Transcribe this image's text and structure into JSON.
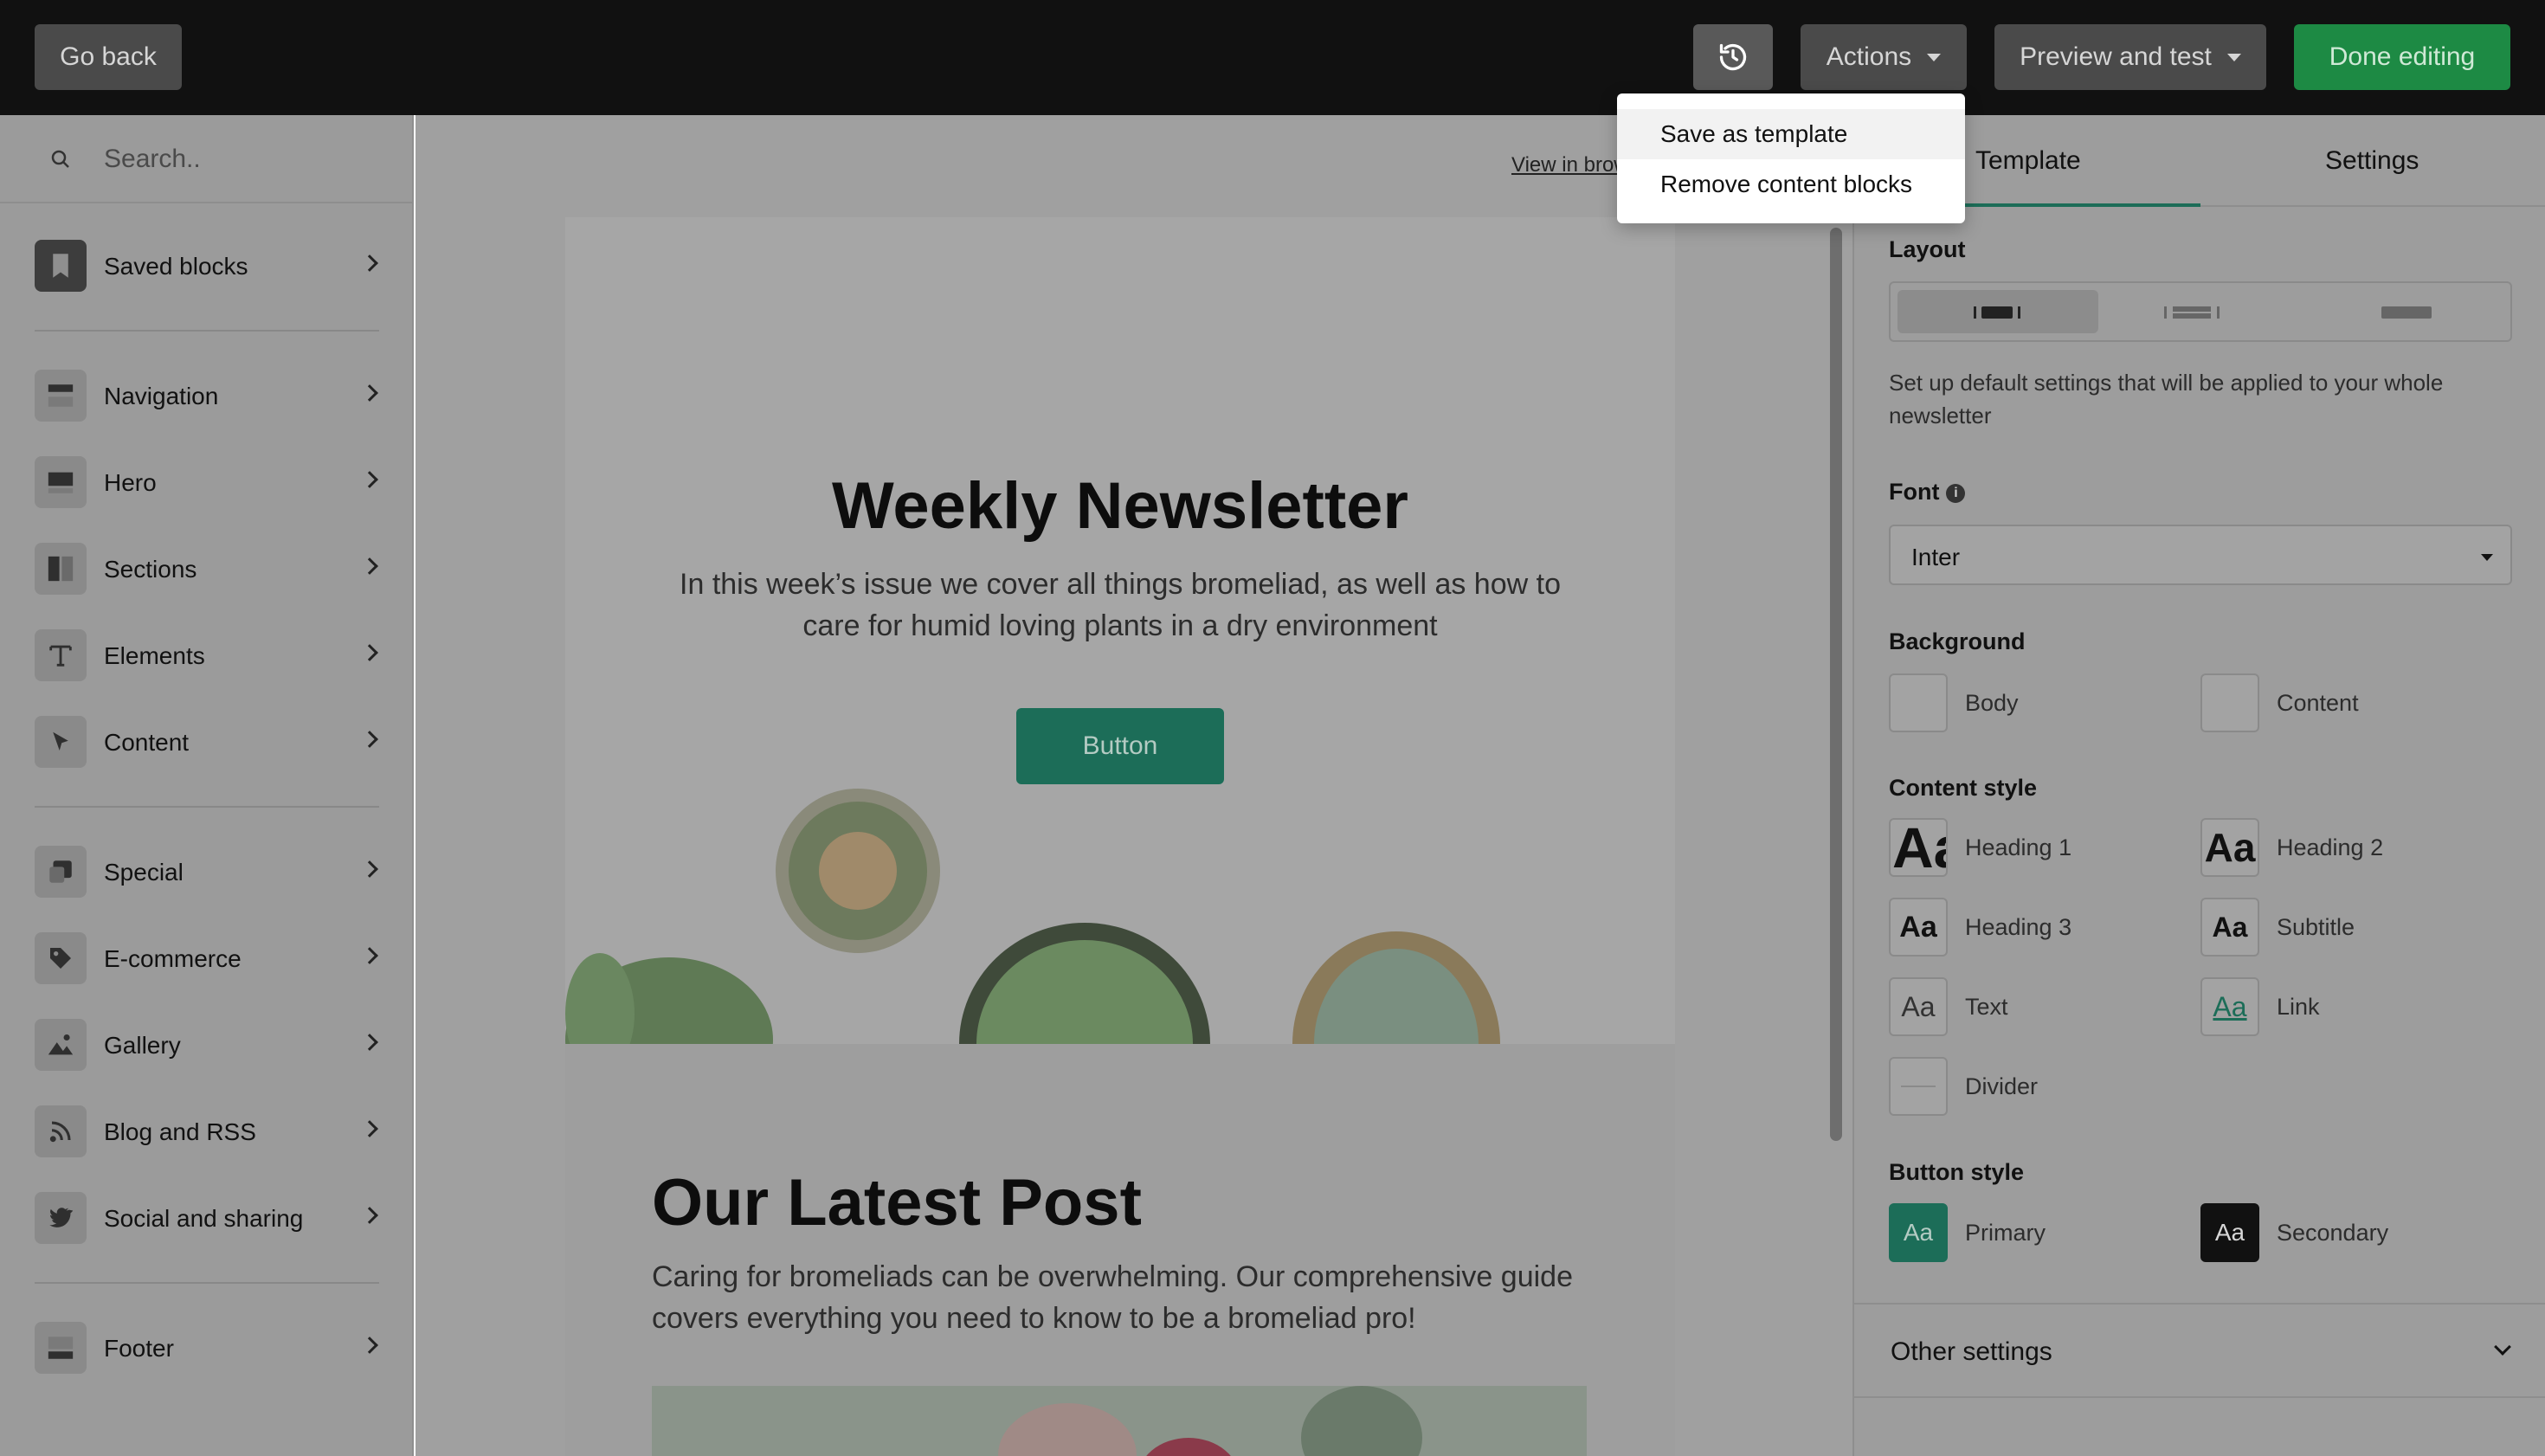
{
  "topbar": {
    "go_back": "Go back",
    "actions": "Actions",
    "preview_and_test": "Preview and test",
    "done_editing": "Done editing"
  },
  "actions_menu": {
    "items": [
      "Save as template",
      "Remove content blocks"
    ]
  },
  "sidebar": {
    "search_placeholder": "Search..",
    "items": [
      {
        "label": "Saved blocks",
        "icon": "bookmark-icon"
      },
      {
        "label": "Navigation",
        "icon": "navigation-icon"
      },
      {
        "label": "Hero",
        "icon": "hero-icon"
      },
      {
        "label": "Sections",
        "icon": "sections-icon"
      },
      {
        "label": "Elements",
        "icon": "text-icon"
      },
      {
        "label": "Content",
        "icon": "cursor-icon"
      },
      {
        "label": "Special",
        "icon": "special-icon"
      },
      {
        "label": "E-commerce",
        "icon": "tag-icon"
      },
      {
        "label": "Gallery",
        "icon": "image-icon"
      },
      {
        "label": "Blog and RSS",
        "icon": "rss-icon"
      },
      {
        "label": "Social and sharing",
        "icon": "twitter-icon"
      },
      {
        "label": "Footer",
        "icon": "footer-icon"
      }
    ]
  },
  "canvas": {
    "view_in_browser": "View in browser",
    "hero_title": "Weekly Newsletter",
    "hero_subtitle": "In this week’s issue we cover all things bromeliad, as well as how to care for humid loving plants in a dry environment",
    "hero_button": "Button",
    "post_title": "Our Latest Post",
    "post_subtitle": "Caring for bromeliads can be overwhelming. Our comprehensive guide covers everything you need to know to be a bromeliad pro!"
  },
  "right_panel": {
    "tabs": [
      "Template",
      "Settings"
    ],
    "active_tab": "Template",
    "layout_label": "Layout",
    "description": "Set up default settings that will be applied to your whole newsletter",
    "font_label": "Font",
    "font_value": "Inter",
    "background_label": "Background",
    "background_items": [
      "Body",
      "Content"
    ],
    "content_style_label": "Content style",
    "content_styles": [
      {
        "sample": "Aa",
        "label": "Heading 1"
      },
      {
        "sample": "Aa",
        "label": "Heading 2"
      },
      {
        "sample": "Aa",
        "label": "Heading 3"
      },
      {
        "sample": "Aa",
        "label": "Subtitle"
      },
      {
        "sample": "Aa",
        "label": "Text"
      },
      {
        "sample": "Aa",
        "label": "Link"
      },
      {
        "sample": "",
        "label": "Divider"
      }
    ],
    "button_style_label": "Button style",
    "button_styles": [
      {
        "sample": "Aa",
        "label": "Primary"
      },
      {
        "sample": "Aa",
        "label": "Secondary"
      }
    ],
    "other_settings": "Other settings"
  },
  "colors": {
    "accent_green": "#1d8a44",
    "primary_button": "#1c6d58",
    "topbar": "#111111"
  }
}
